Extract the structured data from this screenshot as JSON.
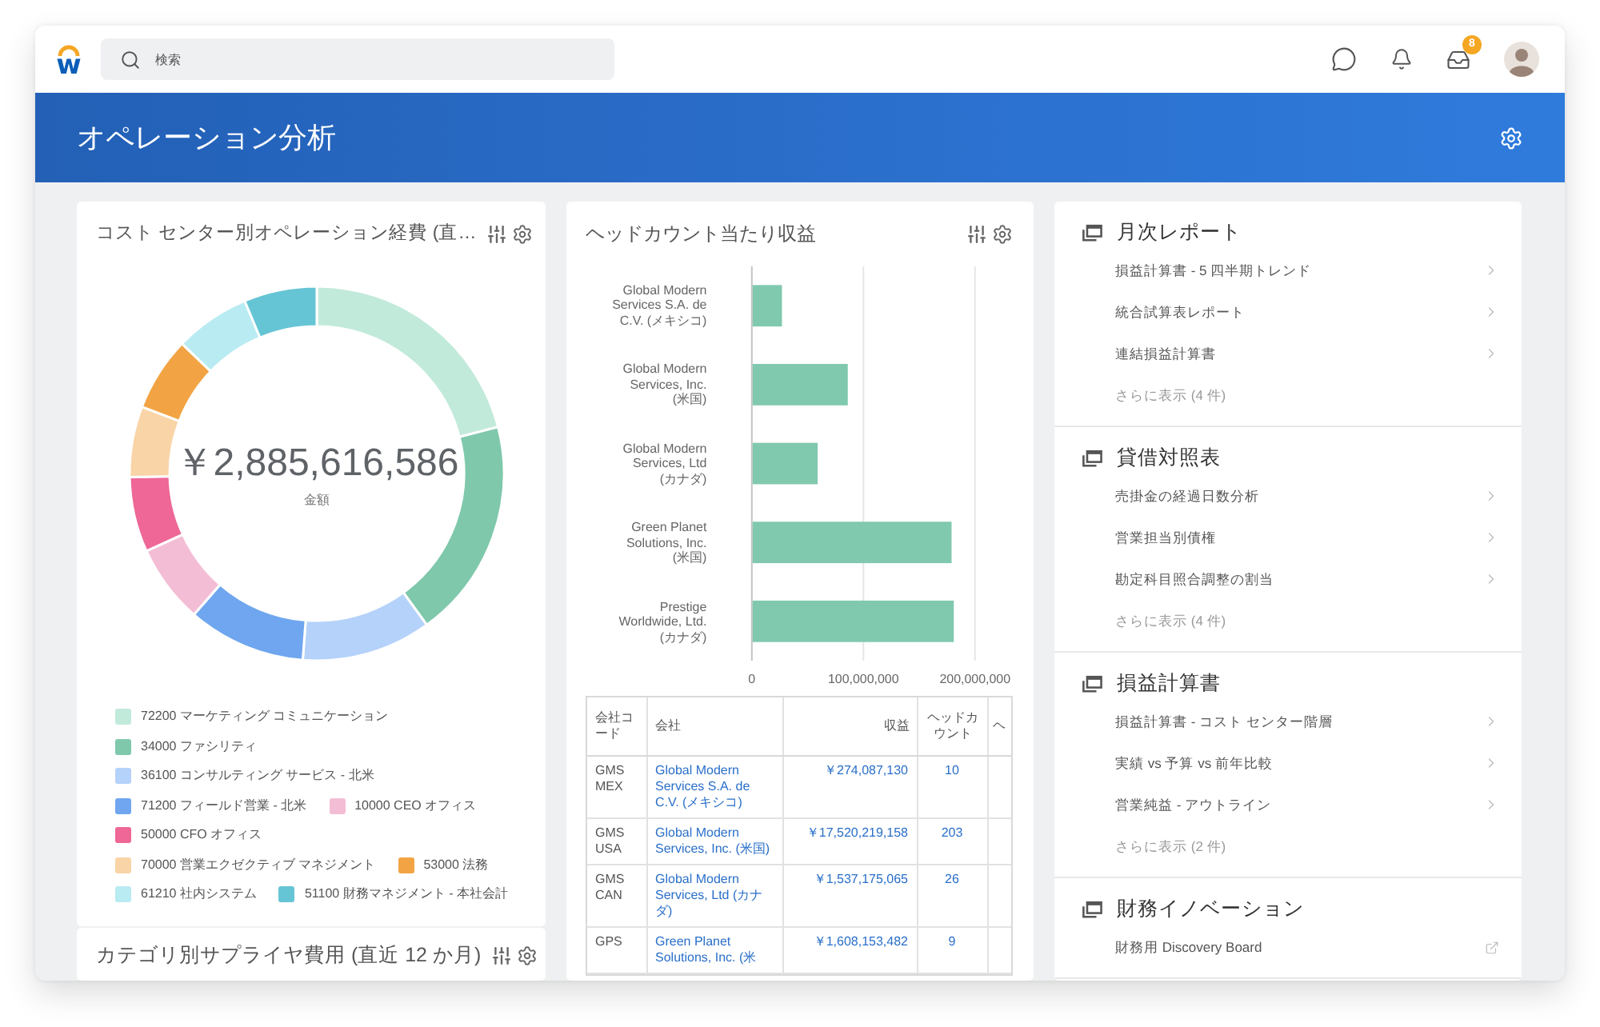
{
  "top_bar": {
    "logo": "w",
    "search": {
      "placeholder": "検索"
    },
    "inbox_badge": "8"
  },
  "header": {
    "title": "オペレーション分析"
  },
  "cost_center_card": {
    "title": "コスト センター別オペレーション経費 (直…",
    "total": "￥2,885,616,586",
    "total_label": "金額",
    "legend": [
      {
        "label": "72200 マーケティング コミュニケーション",
        "color": "#c2eadb"
      },
      {
        "label": "34000 ファシリティ",
        "color": "#7fc8ac"
      },
      {
        "label": "36100 コンサルティング サービス - 北米",
        "color": "#b5d2fa"
      },
      {
        "label": "71200 フィールド営業 - 北米",
        "color": "#6fa6ef"
      },
      {
        "label": "10000 CEO オフィス",
        "color": "#f4bdd6"
      },
      {
        "label": "50000 CFO オフィス",
        "color": "#ee6797"
      },
      {
        "label": "70000 営業エクゼクティブ マネジメント",
        "color": "#f8d4a6"
      },
      {
        "label": "53000 法務",
        "color": "#f2a444"
      },
      {
        "label": "61210 社内システム",
        "color": "#b9ebf2"
      },
      {
        "label": "51100 財務マネジメント - 本社会計",
        "color": "#66c5d5"
      }
    ]
  },
  "supplier_card": {
    "title": "カテゴリ別サプライヤ費用 (直近 12 か月)"
  },
  "headcount_card": {
    "title": "ヘッドカウント当たり収益",
    "chart_data": {
      "type": "bar",
      "orientation": "horizontal",
      "categories": [
        "Global Modern Services S.A. de C.V. (メキシコ)",
        "Global Modern Services, Inc. (米国)",
        "Global Modern Services, Ltd (カナダ)",
        "Green Planet Solutions, Inc. (米国)",
        "Prestige Worldwide, Ltd. (カナダ)"
      ],
      "values": [
        27000000,
        86000000,
        59000000,
        179000000,
        181000000
      ],
      "xlim": [
        0,
        200000000
      ],
      "xticks": [
        {
          "value": 0,
          "label": "0"
        },
        {
          "value": 100000000,
          "label": "100,000,000"
        },
        {
          "value": 200000000,
          "label": "200,000,000"
        }
      ]
    },
    "table": {
      "columns": [
        "会社コード",
        "会社",
        "収益",
        "ヘッドカウント",
        "ヘ"
      ],
      "rows": [
        {
          "code": "GMS MEX",
          "company": "Global Modern Services S.A. de C.V. (メキシコ)",
          "revenue": "￥274,087,130",
          "headcount": "10"
        },
        {
          "code": "GMS USA",
          "company": "Global Modern Services, Inc. (米国)",
          "revenue": "￥17,520,219,158",
          "headcount": "203"
        },
        {
          "code": "GMS CAN",
          "company": "Global Modern Services, Ltd (カナダ)",
          "revenue": "￥1,537,175,065",
          "headcount": "26"
        },
        {
          "code": "GPS",
          "company": "Green Planet Solutions, Inc. (米",
          "revenue": "￥1,608,153,482",
          "headcount": "9"
        }
      ]
    }
  },
  "reports_card": {
    "sections": [
      {
        "title": "月次レポート",
        "items": [
          {
            "label": "損益計算書 - 5 四半期トレンド",
            "kind": "report"
          },
          {
            "label": "統合試算表レポート",
            "kind": "report"
          },
          {
            "label": "連結損益計算書",
            "kind": "report"
          }
        ],
        "more": "さらに表示 (4 件)"
      },
      {
        "title": "貸借対照表",
        "items": [
          {
            "label": "売掛金の経過日数分析",
            "kind": "report"
          },
          {
            "label": "営業担当別債権",
            "kind": "report"
          },
          {
            "label": "勘定科目照合調整の割当",
            "kind": "report"
          }
        ],
        "more": "さらに表示 (4 件)"
      },
      {
        "title": "損益計算書",
        "items": [
          {
            "label": "損益計算書 - コスト センター階層",
            "kind": "report"
          },
          {
            "label": "実績 vs 予算 vs 前年比較",
            "kind": "report"
          },
          {
            "label": "営業純益 - アウトライン",
            "kind": "report"
          }
        ],
        "more": "さらに表示 (2 件)"
      },
      {
        "title": "財務イノベーション",
        "items": [
          {
            "label": "財務用 Discovery Board",
            "kind": "external"
          }
        ]
      }
    ]
  }
}
